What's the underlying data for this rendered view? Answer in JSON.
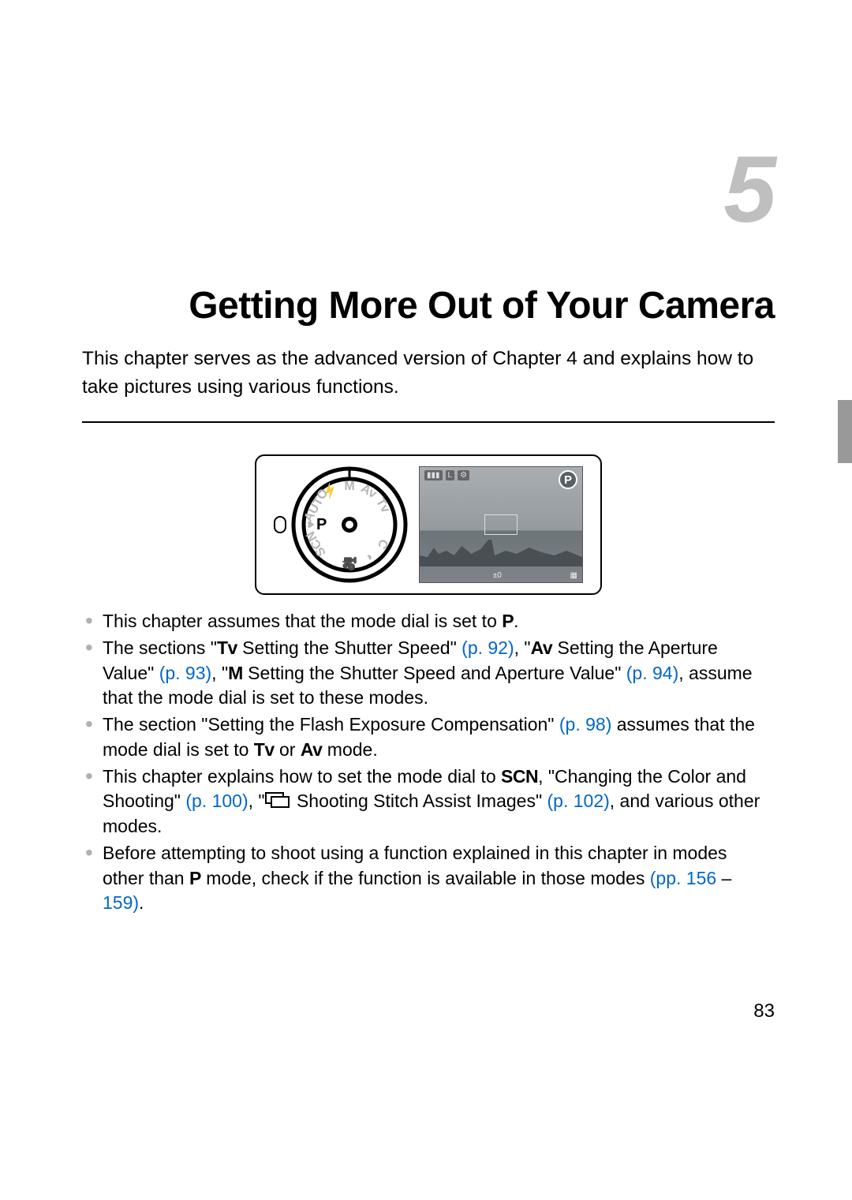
{
  "chapter_number": "5",
  "chapter_title": "Getting More Out of Your Camera",
  "chapter_intro": "This chapter serves as the advanced version of Chapter 4 and explains how to take pictures using various functions.",
  "figure": {
    "dial_selected": "P",
    "lcd_mode": "P",
    "lcd_ev": "±0"
  },
  "icons": {
    "P": "P",
    "Tv": "Tv",
    "Av": "Av",
    "M": "M",
    "SCN": "SCN"
  },
  "bullets": {
    "b1_pre": "This chapter assumes that the mode dial is set to ",
    "b1_post": ".",
    "b2_part1": "The sections \"",
    "b2_part2": " Setting the Shutter Speed\" ",
    "b2_link1": "(p. 92)",
    "b2_part3": ", \"",
    "b2_part4": " Setting the Aperture Value\" ",
    "b2_link2": "(p. 93)",
    "b2_part5": ", \"",
    "b2_part6": " Setting the Shutter Speed and Aperture Value\" ",
    "b2_link3": "(p. 94)",
    "b2_part7": ", assume that the mode dial is set to these modes.",
    "b3_part1": "The section \"Setting the Flash Exposure Compensation\" ",
    "b3_link1": "(p. 98)",
    "b3_part2": " assumes that the mode dial is set to ",
    "b3_part3": " or ",
    "b3_part4": " mode.",
    "b4_part1": "This chapter explains how to set the mode dial to ",
    "b4_part2": ", \"Changing the Color and Shooting\" ",
    "b4_link1": "(p. 100)",
    "b4_part3": ", \"",
    "b4_part4": " Shooting Stitch Assist Images\" ",
    "b4_link2": "(p. 102)",
    "b4_part5": ", and various other modes.",
    "b5_part1": "Before attempting to shoot using a function explained in this chapter in modes other than ",
    "b5_part2": " mode, check if the function is available in those modes ",
    "b5_link1": "(pp. 156",
    "b5_dash": " – ",
    "b5_link2": "159)",
    "b5_part3": "."
  },
  "page_number": "83"
}
